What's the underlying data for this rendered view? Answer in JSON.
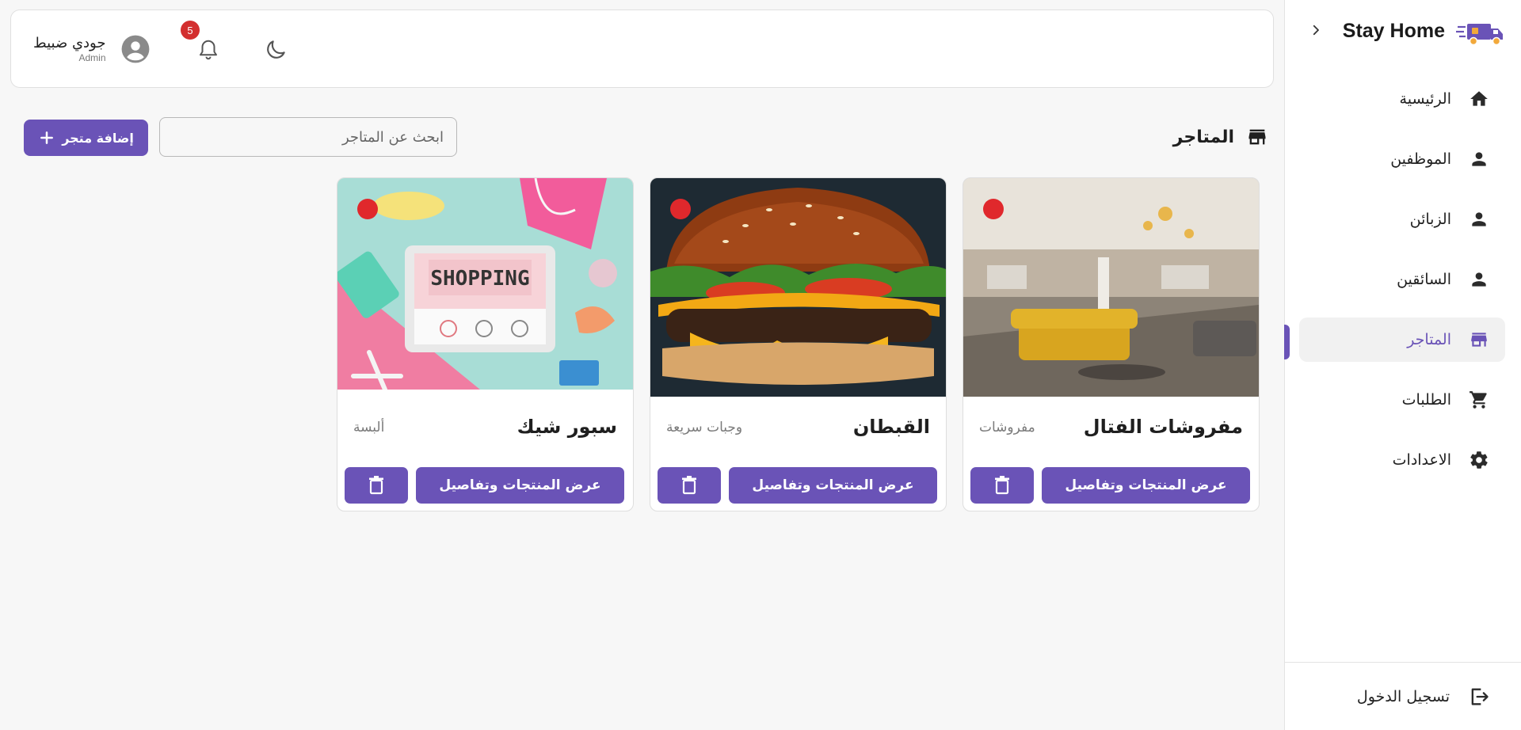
{
  "brand": {
    "title": "Stay Home",
    "truck_icon": "delivery-truck-icon",
    "accent": "#6a53b7"
  },
  "sidebar": {
    "items": [
      {
        "label": "الرئيسية",
        "icon": "home-icon",
        "active": false
      },
      {
        "label": "الموظفين",
        "icon": "person-icon",
        "active": false
      },
      {
        "label": "الزبائن",
        "icon": "person-icon",
        "active": false
      },
      {
        "label": "السائقين",
        "icon": "person-icon",
        "active": false
      },
      {
        "label": "المتاجر",
        "icon": "store-icon",
        "active": true
      },
      {
        "label": "الطلبات",
        "icon": "cart-icon",
        "active": false
      },
      {
        "label": "الاعدادات",
        "icon": "gear-icon",
        "active": false
      }
    ],
    "logout_label": "تسجيل الدخول"
  },
  "header": {
    "user_name": "جودي ضبيط",
    "user_role": "Admin",
    "notification_count": "5"
  },
  "page": {
    "title": "المتاجر",
    "search_placeholder": "ابحث عن المتاجر",
    "add_button": "إضافة متجر"
  },
  "stores": [
    {
      "name": "مفروشات الفتال",
      "category": "مفروشات",
      "details_label": "عرض المنتجات وتفاصيل",
      "status_color": "#e0282c"
    },
    {
      "name": "القبطان",
      "category": "وجبات سريعة",
      "details_label": "عرض المنتجات وتفاصيل",
      "status_color": "#e0282c"
    },
    {
      "name": "سبور شيك",
      "category": "ألبسة",
      "details_label": "عرض المنتجات وتفاصيل",
      "status_color": "#e0282c",
      "image_text": "SHOPPING"
    }
  ]
}
